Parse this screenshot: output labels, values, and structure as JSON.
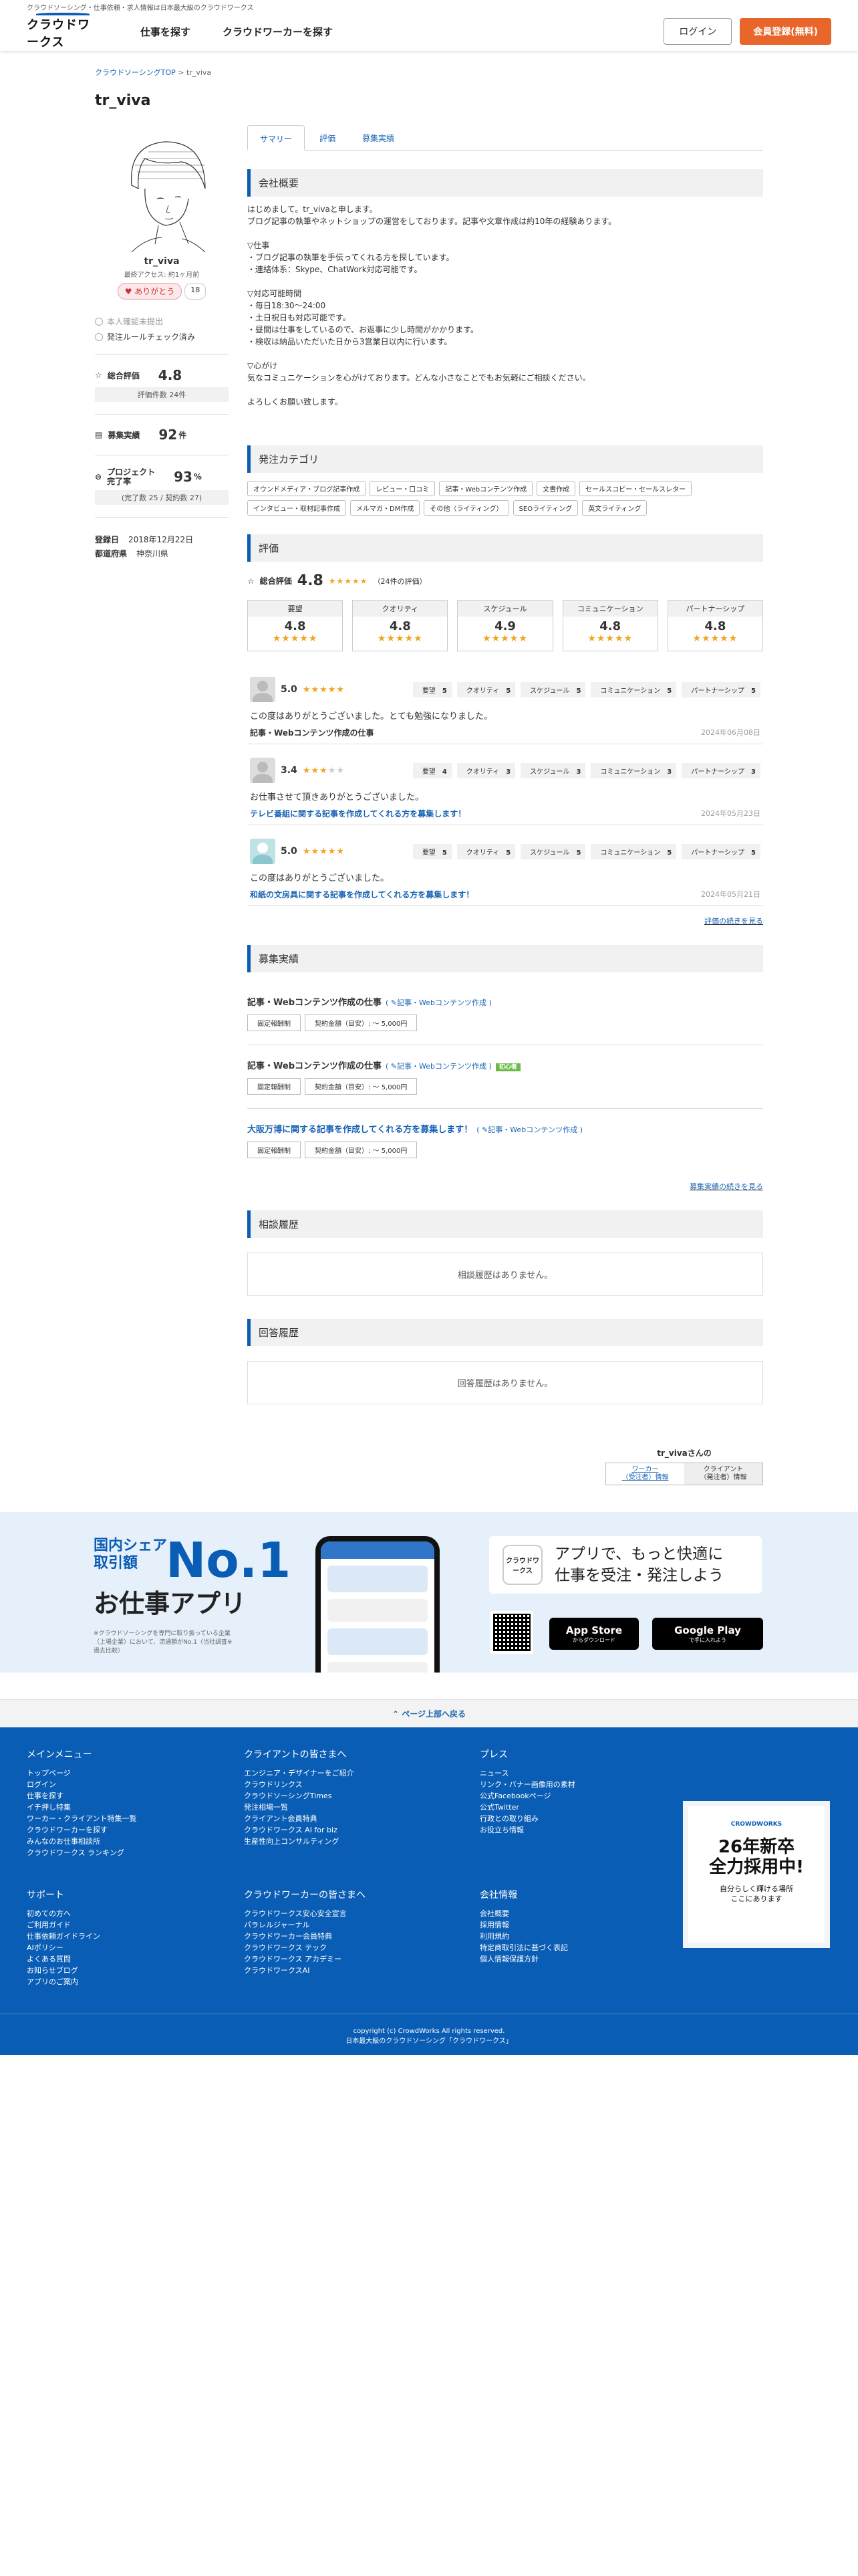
{
  "topstrip": "クラウドソーシング・仕事依頼・求人情報は日本最大級のクラウドワークス",
  "header": {
    "logo": "クラウドワークス",
    "nav": [
      "仕事を探す",
      "クラウドワーカーを探す"
    ],
    "login": "ログイン",
    "register": "会員登録(無料)"
  },
  "breadcrumb": {
    "top": "クラウドソーシングTOP",
    "sep": ">",
    "current": "tr_viva"
  },
  "profile": {
    "name": "tr_viva",
    "last_access": "最終アクセス: 約1ヶ月前",
    "thanks_label": "ありがとう",
    "thanks_count": "18",
    "verify_id": "本人確認未提出",
    "verify_rule": "発注ルールチェック済み",
    "rating_label": "総合評価",
    "rating_value": "4.8",
    "rating_count": "評価件数 24件",
    "jobs_label": "募集実績",
    "jobs_value": "92",
    "jobs_unit": "件",
    "completion_label": "プロジェクト\n完了率",
    "completion_value": "93",
    "completion_unit": "%",
    "completion_detail": "(完了数 25 / 契約数 27)",
    "registered_label": "登録日",
    "registered_value": "2018年12月22日",
    "pref_label": "都道府県",
    "pref_value": "神奈川県"
  },
  "tabs": [
    "サマリー",
    "評価",
    "募集実績"
  ],
  "summary": {
    "heading": "会社概要",
    "paragraphs": [
      "はじめまして。tr_vivaと申します。\nブログ記事の執筆やネットショップの運営をしております。記事や文章作成は約10年の経験あります。",
      "▽仕事\n・ブログ記事の執筆を手伝ってくれる方を探しています。\n・連絡体系：Skype、ChatWork対応可能です。",
      "▽対応可能時間\n・毎日18:30〜24:00\n・土日祝日も対応可能です。\n・昼間は仕事をしているので、お返事に少し時間がかかります。\n・検収は納品いただいた日から3営業日以内に行います。",
      "▽心がけ\n気なコミュニケーションを心がけております。どんな小さなことでもお気軽にご相談ください。",
      "よろしくお願い致します。"
    ]
  },
  "categories": {
    "heading": "発注カテゴリ",
    "items": [
      "オウンドメディア・ブログ記事作成",
      "レビュー・口コミ",
      "記事・Webコンテンツ作成",
      "文書作成",
      "セールスコピー・セールスレター",
      "インタビュー・取材記事作成",
      "メルマガ・DM作成",
      "その他（ライティング）",
      "SEOライティング",
      "英文ライティング"
    ]
  },
  "ratings": {
    "heading": "評価",
    "overall_label": "総合評価",
    "overall_value": "4.8",
    "overall_count": "（24件の評価）",
    "criteria": [
      {
        "label": "要望",
        "value": "4.8"
      },
      {
        "label": "クオリティ",
        "value": "4.8"
      },
      {
        "label": "スケジュール",
        "value": "4.9"
      },
      {
        "label": "コミュニケーション",
        "value": "4.8"
      },
      {
        "label": "パートナーシップ",
        "value": "4.8"
      }
    ],
    "reviews": [
      {
        "score": "5.0",
        "stars": 5,
        "c": [
          "要望",
          "5",
          "クオリティ",
          "5",
          "スケジュール",
          "5",
          "コミュニケーション",
          "5",
          "パートナーシップ",
          "5"
        ],
        "comment": "この度はありがとうございました。とても勉強になりました。",
        "job": "記事・Webコンテンツ作成の仕事",
        "date": "2024年06月08日"
      },
      {
        "score": "3.4",
        "stars": 3,
        "c": [
          "要望",
          "4",
          "クオリティ",
          "3",
          "スケジュール",
          "3",
          "コミュニケーション",
          "3",
          "パートナーシップ",
          "3"
        ],
        "comment": "お仕事させて頂きありがとうございました。",
        "job": "テレビ番組に関する記事を作成してくれる方を募集します！",
        "date": "2024年05月23日"
      },
      {
        "score": "5.0",
        "stars": 5,
        "c": [
          "要望",
          "5",
          "クオリティ",
          "5",
          "スケジュール",
          "5",
          "コミュニケーション",
          "5",
          "パートナーシップ",
          "5"
        ],
        "comment": "この度はありがとうございました。",
        "job": "和紙の文房具に関する記事を作成してくれる方を募集します！",
        "date": "2024年05月21日"
      }
    ],
    "more": "評価の続きを見る"
  },
  "jobs": {
    "heading": "募集実績",
    "items": [
      {
        "title": "記事・Webコンテンツ作成の仕事",
        "category": "記事・Webコンテンツ作成",
        "new": "",
        "type": "固定報酬制",
        "budget": "契約金額（目安）: 〜 5,000円"
      },
      {
        "title": "記事・Webコンテンツ作成の仕事",
        "category": "記事・Webコンテンツ作成",
        "new": "初心者",
        "type": "固定報酬制",
        "budget": "契約金額（目安）: 〜 5,000円"
      },
      {
        "title": "大阪万博に関する記事を作成してくれる方を募集します！",
        "category": "記事・Webコンテンツ作成",
        "new": "",
        "type": "固定報酬制",
        "budget": "契約金額（目安）: 〜 5,000円"
      }
    ],
    "more": "募集実績の続きを見る"
  },
  "consult": {
    "heading": "相談履歴",
    "empty": "相談履歴はありません。"
  },
  "answers": {
    "heading": "回答履歴",
    "empty": "回答履歴はありません。"
  },
  "sidecard": {
    "name": "tr_vivaさんの",
    "worker": "ワーカー\n（受注者）情報",
    "client": "クライアント\n（発注者）情報"
  },
  "appband": {
    "share": "国内シェア\n取引額",
    "no1": "No.1",
    "title": "お仕事アプリ",
    "note": "※クラウドソーシングを専門に取り扱っている企業（上場企業）において、流通額がNo.1（当社調査※過去比較）",
    "app_icon": "クラウドワークス",
    "cta": "アプリで、もっと快適に\n仕事を受注・発注しよう",
    "appstore": "App Store",
    "appstore_small": "からダウンロード",
    "googleplay": "Google Play",
    "googleplay_small": "で手に入れよう"
  },
  "totop": "⌃ ページ上部へ戻る",
  "footer": {
    "cols": [
      {
        "h": "メインメニュー",
        "items": [
          "トップページ",
          "ログイン",
          "仕事を探す",
          "イチ押し特集",
          "ワーカー・クライアント特集一覧",
          "クラウドワーカーを探す",
          "みんなのお仕事相談所",
          "クラウドワークス ランキング"
        ]
      },
      {
        "h": "クライアントの皆さまへ",
        "items": [
          "エンジニア・デザイナーをご紹介",
          "クラウドリンクス",
          "クラウドソーシングTimes",
          "発注相場一覧",
          "クライアント会員特典",
          "クラウドワークス AI for biz",
          "生産性向上コンサルティング"
        ]
      },
      {
        "h": "プレス",
        "items": [
          "ニュース",
          "リンク・バナー画像用の素材",
          "公式Facebookページ",
          "公式Twitter",
          "行政との取り組み",
          "お役立ち情報"
        ]
      },
      {
        "h": "サポート",
        "items": [
          "初めての方へ",
          "ご利用ガイド",
          "仕事依頼ガイドライン",
          "AIポリシー",
          "よくある質問",
          "お知らせブログ",
          "アプリのご案内"
        ]
      },
      {
        "h": "クラウドワーカーの皆さまへ",
        "items": [
          "クラウドワークス安心安全宣言",
          "パラレルジャーナル",
          "クラウドワーカー会員特典",
          "クラウドワークス テック",
          "クラウドワークス アカデミー",
          "クラウドワークスAI"
        ]
      },
      {
        "h": "会社情報",
        "items": [
          "会社概要",
          "採用情報",
          "利用規約",
          "特定商取引法に基づく表記",
          "個人情報保護方針"
        ]
      }
    ],
    "recruit_logo": "CROWDWORKS",
    "recruit_title": "26年新卒\n全力採用中!",
    "recruit_sub": "自分らしく輝ける場所\nここにあります",
    "copyright": "copyright (c) CrowdWorks All rights reserved.",
    "tagline": "日本最大級のクラウドソーシング「クラウドワークス」"
  }
}
